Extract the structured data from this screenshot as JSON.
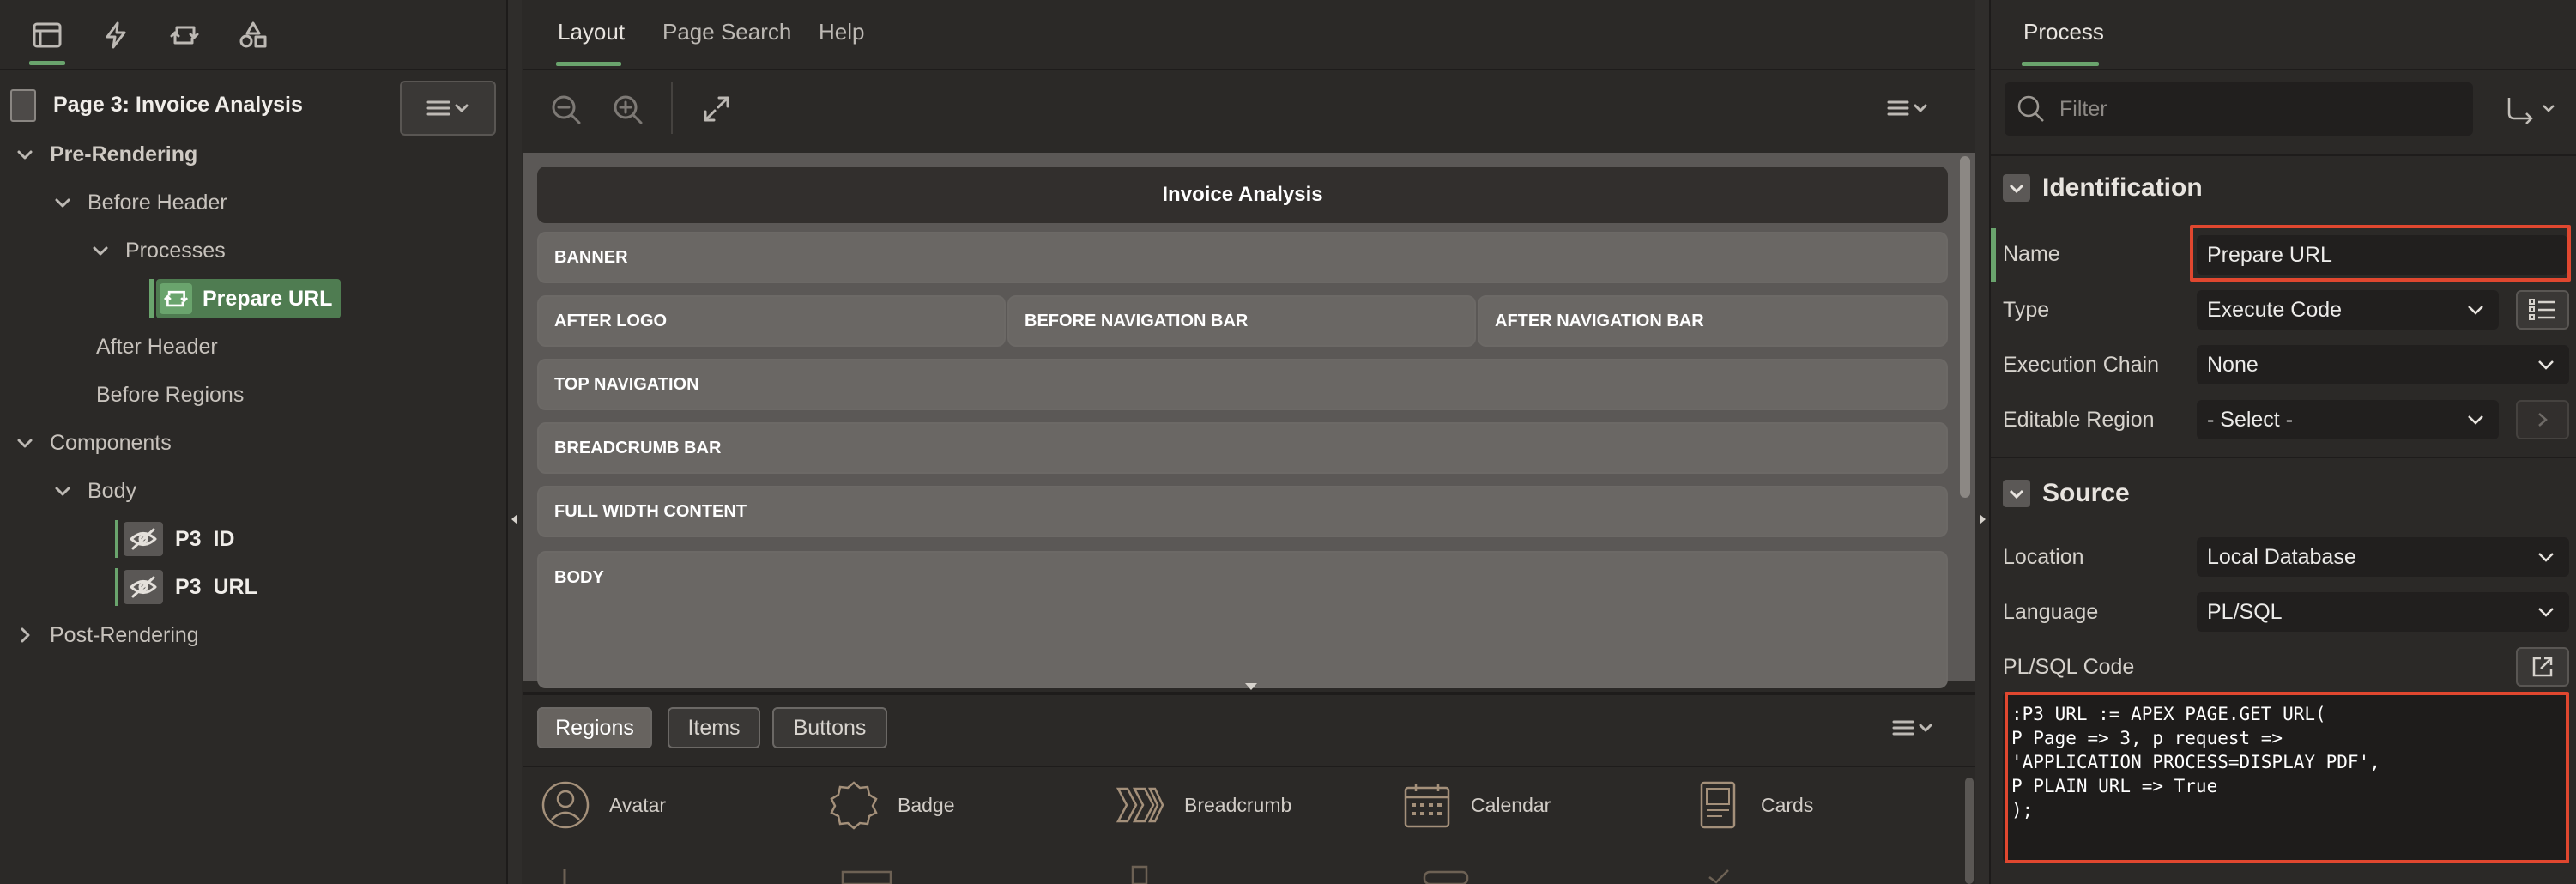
{
  "left": {
    "page_title": "Page 3: Invoice Analysis",
    "tree": {
      "pre_rendering": "Pre-Rendering",
      "before_header": "Before Header",
      "processes": "Processes",
      "prepare_url": "Prepare URL",
      "after_header": "After Header",
      "before_regions": "Before Regions",
      "components": "Components",
      "body": "Body",
      "p3_id": "P3_ID",
      "p3_url": "P3_URL",
      "post_rendering": "Post-Rendering"
    }
  },
  "center": {
    "tabs": [
      "Layout",
      "Page Search",
      "Help"
    ],
    "page_name": "Invoice Analysis",
    "slots": {
      "banner": "BANNER",
      "after_logo": "AFTER LOGO",
      "before_nav": "BEFORE NAVIGATION BAR",
      "after_nav": "AFTER NAVIGATION BAR",
      "top_nav": "TOP NAVIGATION",
      "breadcrumb_bar": "BREADCRUMB BAR",
      "full_width": "FULL WIDTH CONTENT",
      "body": "BODY"
    },
    "gallery_tabs": [
      "Regions",
      "Items",
      "Buttons"
    ],
    "gallery_items": [
      "Avatar",
      "Badge",
      "Breadcrumb",
      "Calendar",
      "Cards"
    ]
  },
  "right": {
    "tab": "Process",
    "filter_placeholder": "Filter",
    "identification": {
      "header": "Identification",
      "name_label": "Name",
      "name_value": "Prepare URL",
      "type_label": "Type",
      "type_value": "Execute Code",
      "chain_label": "Execution Chain",
      "chain_value": "None",
      "region_label": "Editable Region",
      "region_value": "- Select -"
    },
    "source": {
      "header": "Source",
      "location_label": "Location",
      "location_value": "Local Database",
      "language_label": "Language",
      "language_value": "PL/SQL",
      "code_label": "PL/SQL Code",
      "code_value": ":P3_URL := APEX_PAGE.GET_URL(\nP_Page => 3, p_request =>\n'APPLICATION_PROCESS=DISPLAY_PDF',\nP_PLAIN_URL => True\n);"
    }
  },
  "colors": {
    "accent_green": "#6aa46d",
    "highlight_red": "#e0472f",
    "panel_bg": "#2b2927"
  }
}
